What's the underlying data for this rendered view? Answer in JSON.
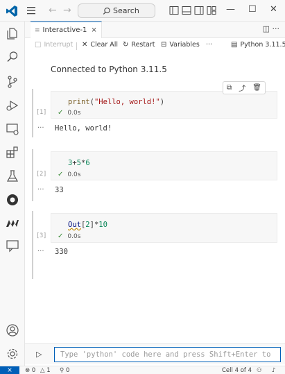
{
  "titlebar": {
    "search_label": "Search",
    "back_arrow": "←",
    "forward_arrow": "→",
    "minimize": "—",
    "maximize": "☐",
    "close": "✕"
  },
  "tab": {
    "name": "Interactive-1",
    "close": "×",
    "actions": "◫  ···"
  },
  "toolbar": {
    "interrupt": "Interrupt",
    "clear_all": "Clear All",
    "restart": "Restart",
    "variables": "Variables",
    "more": "···",
    "kernel": "Python 3.11.5"
  },
  "connected": "Connected to Python 3.11.5",
  "cells": [
    {
      "exec": "[1]",
      "code": "print(\"Hello, world!\")",
      "status": "0.0s",
      "output": "Hello, world!"
    },
    {
      "exec": "[2]",
      "code": "3+5*6",
      "status": "0.0s",
      "output": "33"
    },
    {
      "exec": "[3]",
      "code": "Out[2]*10",
      "status": "0.0s",
      "output": "330"
    }
  ],
  "output_dots": "···",
  "input": {
    "placeholder": "Type 'python' code here and press Shift+Enter to run"
  },
  "statusbar": {
    "errors": "0",
    "warnings": "1",
    "ports": "0",
    "cell_position": "Cell 4 of 4"
  },
  "colors": {
    "accent": "#005fb8",
    "success": "#388a34"
  }
}
